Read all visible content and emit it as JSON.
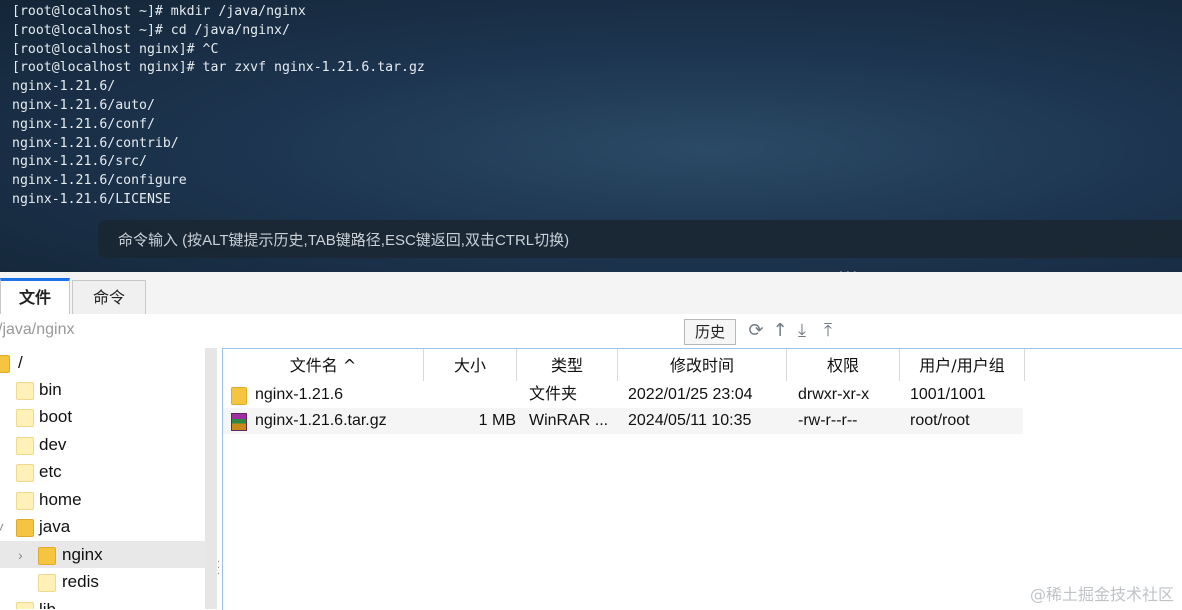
{
  "terminal": {
    "lines": [
      "[root@localhost ~]# mkdir /java/nginx",
      "[root@localhost ~]# cd /java/nginx/",
      "[root@localhost nginx]# ^C",
      "[root@localhost nginx]# tar zxvf nginx-1.21.6.tar.gz",
      "nginx-1.21.6/",
      "nginx-1.21.6/auto/",
      "nginx-1.21.6/conf/",
      "nginx-1.21.6/contrib/",
      "nginx-1.21.6/src/",
      "nginx-1.21.6/configure",
      "nginx-1.21.6/LICENSE"
    ],
    "command_hint": "命令输入 (按ALT键提示历史,TAB键路径,ESC键返回,双击CTRL切换)"
  },
  "tabs": [
    {
      "label": "文件",
      "active": true
    },
    {
      "label": "命令",
      "active": false
    }
  ],
  "pathbar": {
    "path": "/java/nginx",
    "history_label": "历史",
    "icons": [
      "refresh-icon",
      "upload-arrow-icon",
      "download-icon",
      "upload-icon"
    ]
  },
  "tree": {
    "items": [
      "/",
      "bin",
      "boot",
      "dev",
      "etc",
      "home",
      "java",
      "nginx",
      "redis",
      "lib"
    ],
    "selected": "nginx"
  },
  "filelist": {
    "columns": [
      "文件名 ^",
      "大小",
      "类型",
      "修改时间",
      "权限",
      "用户/用户组"
    ],
    "rows": [
      {
        "name": "nginx-1.21.6",
        "size": "",
        "type": "文件夹",
        "modified": "2022/01/25 23:04",
        "perm": "drwxr-xr-x",
        "owner": "1001/1001",
        "icon": "folder-icon"
      },
      {
        "name": "nginx-1.21.6.tar.gz",
        "size": "1 MB",
        "type": "WinRAR ...",
        "modified": "2024/05/11 10:35",
        "perm": "-rw-r--r--",
        "owner": "root/root",
        "icon": "winrar-archive-icon"
      }
    ]
  },
  "watermark": "@稀土掘金技术社区"
}
